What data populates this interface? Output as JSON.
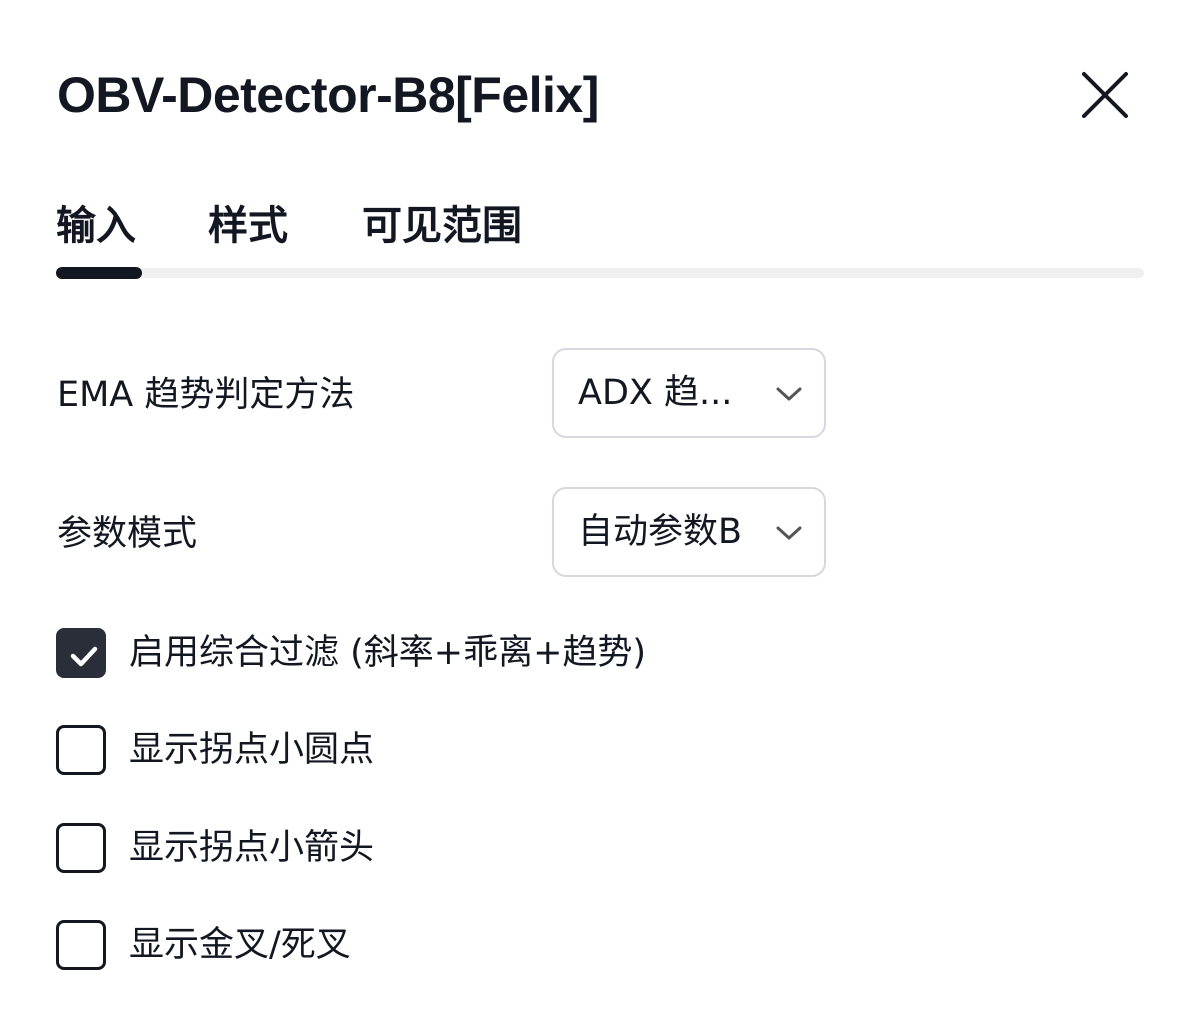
{
  "dialog": {
    "title": "OBV-Detector-B8[Felix]"
  },
  "tabs": [
    {
      "label": "输入",
      "active": true
    },
    {
      "label": "样式",
      "active": false
    },
    {
      "label": "可见范围",
      "active": false
    }
  ],
  "settings": {
    "ema_trend_method": {
      "label": "EMA 趋势判定方法",
      "value": "ADX 趋..."
    },
    "param_mode": {
      "label": "参数模式",
      "value": "自动参数B"
    }
  },
  "checkboxes": [
    {
      "label": "启用综合过滤 (斜率+乖离+趋势)",
      "checked": true
    },
    {
      "label": "显示拐点小圆点",
      "checked": false
    },
    {
      "label": "显示拐点小箭头",
      "checked": false
    },
    {
      "label": "显示金叉/死叉",
      "checked": false
    }
  ],
  "icons": {
    "close": "close-icon",
    "dropdown": "chevron-down-icon",
    "check": "checkmark-icon"
  },
  "colors": {
    "text": "#131722",
    "checked_fill": "#2a2e39",
    "select_border": "#d6d8de",
    "tab_track": "#f0f0f0"
  }
}
